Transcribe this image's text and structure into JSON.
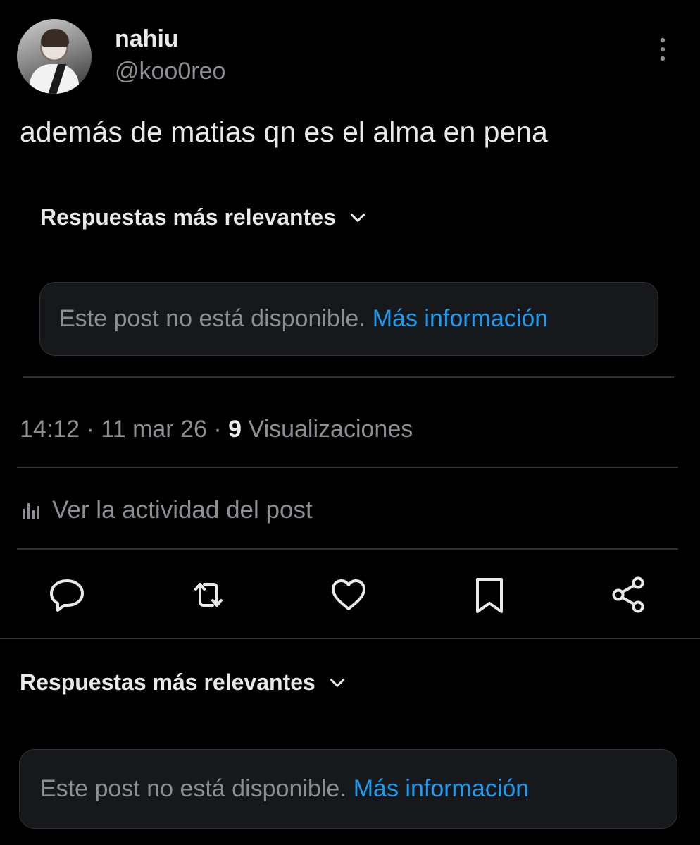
{
  "author": {
    "display_name": "nahiu",
    "handle": "@koo0reo"
  },
  "tweet": {
    "text": "además de matias qn es el alma en pena"
  },
  "sort_label": "Respuestas más relevantes",
  "unavailable": {
    "text": "Este post no está disponible.",
    "link": "Más información"
  },
  "meta": {
    "time": "14:12",
    "date": "11 mar 26",
    "views_count": "9",
    "views_label": "Visualizaciones",
    "separator": "·"
  },
  "activity_label": "Ver la actividad del post",
  "icons": {
    "more": "more-vertical-icon",
    "reply": "reply-icon",
    "retweet": "retweet-icon",
    "like": "heart-icon",
    "bookmark": "bookmark-icon",
    "share": "share-icon",
    "chevron": "chevron-down-icon",
    "analytics": "analytics-icon"
  },
  "colors": {
    "background": "#000000",
    "text": "#e7e9ea",
    "secondary": "#8b8f94",
    "link": "#1d9bf0",
    "card": "#16181c",
    "border": "#2f3336"
  }
}
